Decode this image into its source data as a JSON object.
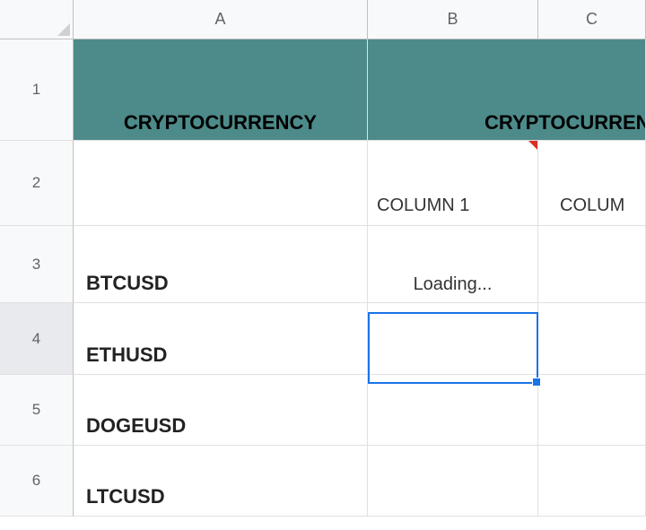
{
  "columns": {
    "A": "A",
    "B": "B",
    "C": "C"
  },
  "rows": {
    "r1": "1",
    "r2": "2",
    "r3": "3",
    "r4": "4",
    "r5": "5",
    "r6": "6"
  },
  "headers": {
    "cryptocurrency": "CRYPTOCURRENCY",
    "cryptocurrency_b": "CRYPTOCURREN",
    "column1": "COLUMN 1",
    "column2": "COLUM"
  },
  "data": {
    "a3": "BTCUSD",
    "b3": "Loading...",
    "a4": "ETHUSD",
    "a5": "DOGEUSD",
    "a6": "LTCUSD"
  },
  "selection": {
    "cell": "B4",
    "row": 4
  }
}
